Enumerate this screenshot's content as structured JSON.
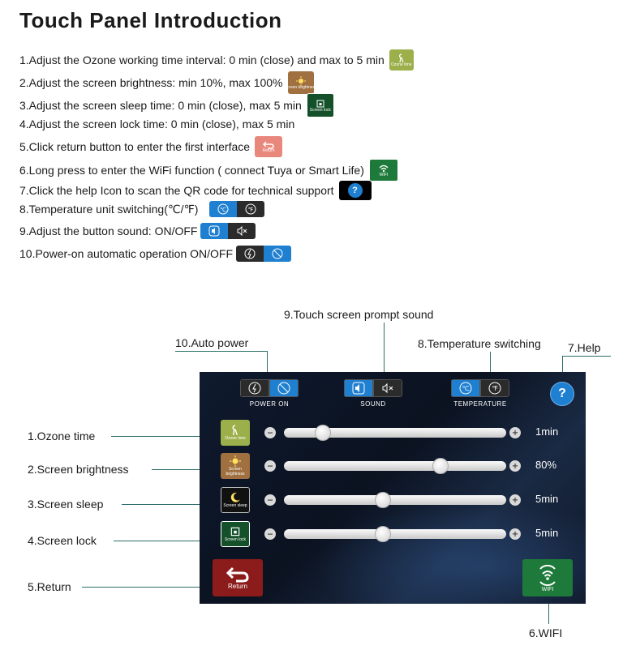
{
  "title": "Touch Panel Introduction",
  "instructions": [
    "1.Adjust the Ozone working time interval: 0 min (close) and max to 5 min",
    "2.Adjust the screen brightness: min 10%, max 100%",
    "3.Adjust the screen sleep time:  0 min (close), max 5 min",
    "4.Adjust the screen lock time: 0 min (close), max 5 min",
    "5.Click return button to enter the first interface",
    "6.Long press to enter the WiFi function ( connect Tuya or Smart Life)",
    "7.Click the help Icon to scan the QR code for technical support",
    "8.Temperature unit switching(℃/℉)",
    "9.Adjust the button sound: ON/OFF",
    "10.Power-on automatic operation ON/OFF"
  ],
  "icon_labels": {
    "ozone": "Ozone time",
    "brightness": "Screen brightness",
    "lock": "Screen lock",
    "return": "Return",
    "wifi": "WIFI",
    "help": "?"
  },
  "callouts": {
    "sound": "9.Touch screen prompt sound",
    "auto_power": "10.Auto power",
    "temperature": "8.Temperature switching",
    "help": "7.Help",
    "ozone": "1.Ozone time",
    "brightness": "2.Screen brightness",
    "sleep": "3.Screen sleep",
    "lock": "4.Screen lock",
    "return": "5.Return",
    "wifi": "6.WIFI"
  },
  "panel": {
    "power_label": "POWER ON",
    "sound_label": "SOUND",
    "temp_label": "TEMPERATURE",
    "celsius": "℃",
    "fahrenheit": "℉",
    "help": "?",
    "minus": "−",
    "plus": "+",
    "sliders": [
      {
        "icon_label": "Ozone time",
        "value_text": "1min",
        "level": 0.15
      },
      {
        "icon_label": "Screen brightness",
        "value_text": "80%",
        "level": 0.72
      },
      {
        "icon_label": "Screen sleep",
        "value_text": "5min",
        "level": 0.44
      },
      {
        "icon_label": "Screen lock",
        "value_text": "5min",
        "level": 0.44
      }
    ],
    "return_label": "Return",
    "wifi_label": "WIFI"
  },
  "colors": {
    "ozone": "#9bb04a",
    "brightness": "#a07040",
    "sleep": "#111111",
    "lock": "#14502a",
    "return": "#8c1c1c",
    "wifi": "#1e7a3a",
    "accent": "#1f7fd0",
    "line": "#2d6e6a"
  }
}
